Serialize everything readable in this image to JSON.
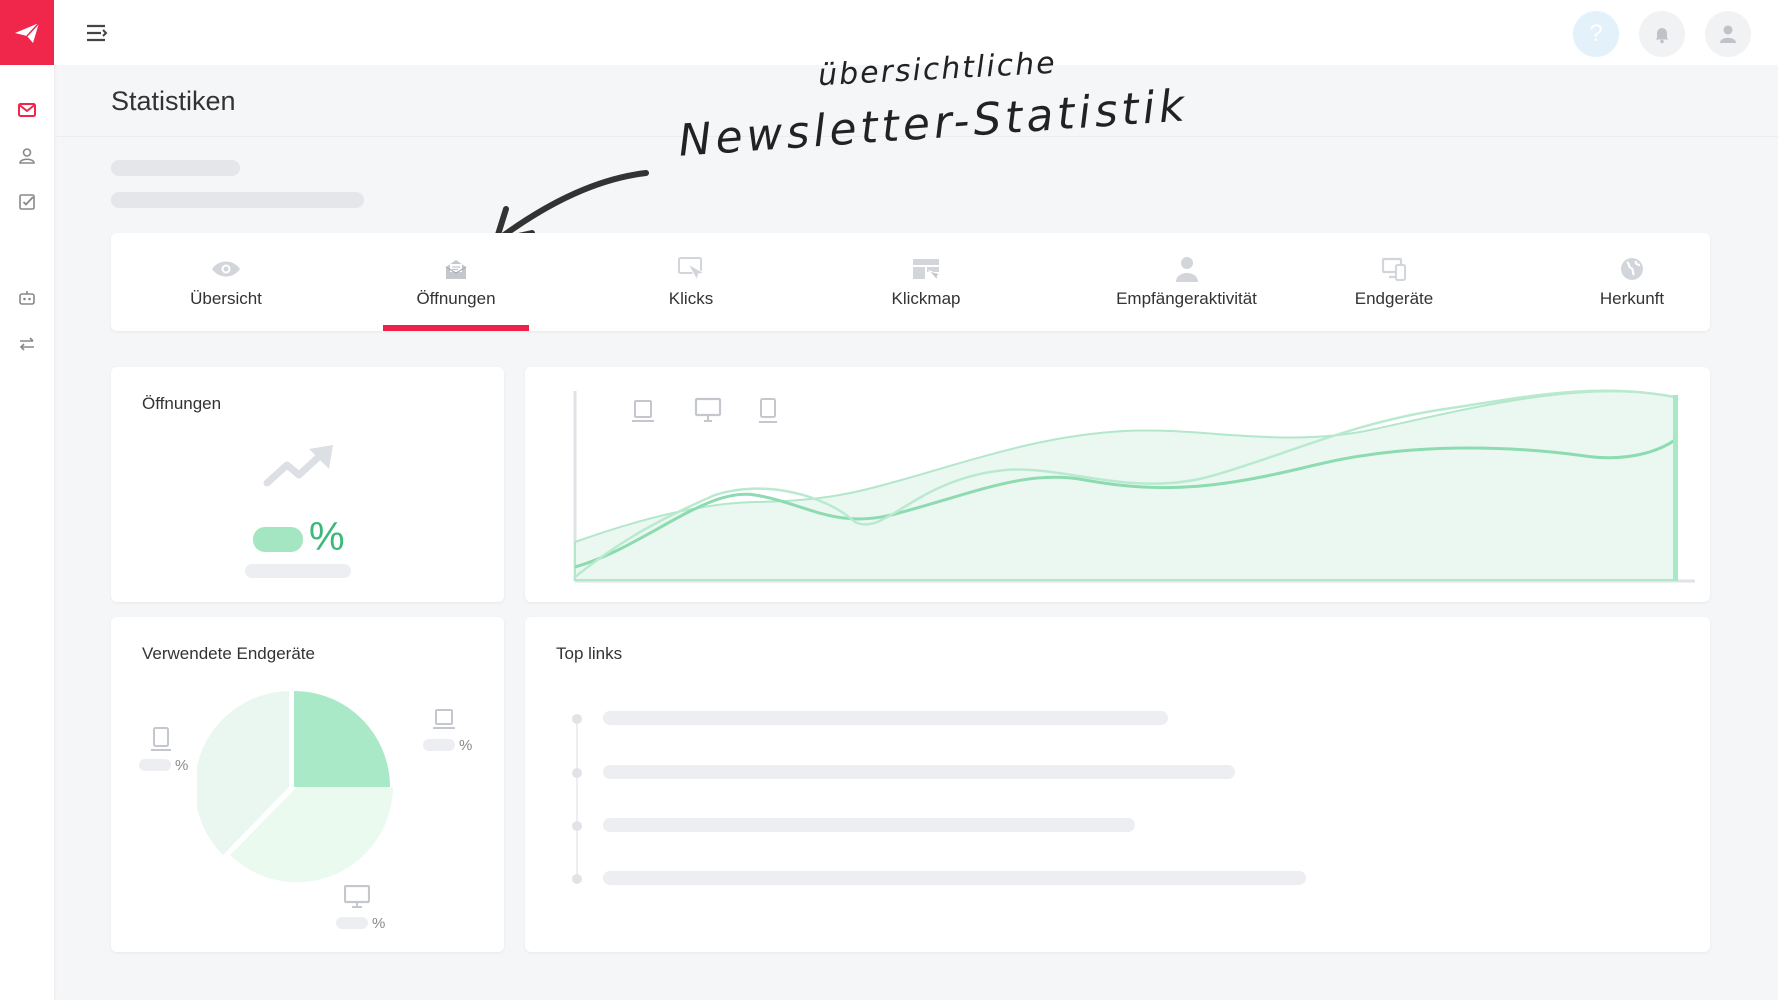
{
  "page": {
    "title": "Statistiken"
  },
  "annotation": {
    "line1": "übersichtliche",
    "line2": "Newsletter-Statistik"
  },
  "topbar": {
    "help_label": "?"
  },
  "tabs": [
    {
      "label": "Übersicht",
      "icon": "eye-icon",
      "active": false
    },
    {
      "label": "Öffnungen",
      "icon": "open-mail-icon",
      "active": true
    },
    {
      "label": "Klicks",
      "icon": "cursor-click-icon",
      "active": false
    },
    {
      "label": "Klickmap",
      "icon": "clickmap-icon",
      "active": false
    },
    {
      "label": "Empfängeraktivität",
      "icon": "person-icon",
      "active": false
    },
    {
      "label": "Endgeräte",
      "icon": "devices-icon",
      "active": false
    },
    {
      "label": "Herkunft",
      "icon": "globe-icon",
      "active": false
    }
  ],
  "cards": {
    "openings": {
      "title": "Öffnungen",
      "percent_symbol": "%"
    },
    "devices": {
      "title": "Verwendete Endgeräte",
      "percent_symbol": "%"
    },
    "top_links": {
      "title": "Top links"
    }
  },
  "colors": {
    "brand": "#f0264a",
    "active_tab": "#ee2148",
    "chart_green": "#a7e8c5",
    "chart_line": "#7fd7a6",
    "percent_green": "#3cb879"
  }
}
